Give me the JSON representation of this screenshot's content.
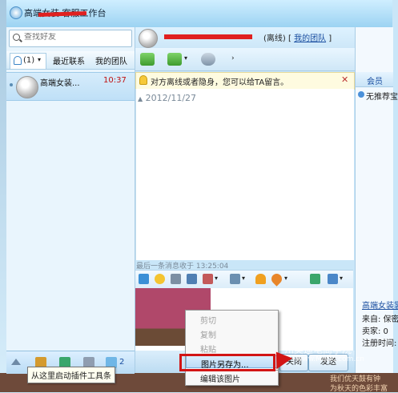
{
  "window": {
    "title": "高端女装 客服工作台"
  },
  "search": {
    "placeholder": "查找好友"
  },
  "tabs": {
    "contacts_count": "(1)",
    "recent": "最近联系",
    "team": "我的团队"
  },
  "contact": {
    "name": "高端女装...",
    "time": "10:37"
  },
  "left_toolbar": {
    "badge": "2"
  },
  "tooltip": "从这里启动插件工具条",
  "chat": {
    "status": "(离线)",
    "team_link": "我的团队",
    "notice": "对方离线或者隐身，您可以给TA留言。",
    "notice_close": "✕",
    "date_separator": "2012/11/27",
    "last_message": "最后一条消息收于 13:25:04",
    "send_label": "发送",
    "close_label": "关闭"
  },
  "right_panel": {
    "tab_label": "会员",
    "not_saved": "无推荐宝",
    "shop_link": "高端女装裳",
    "lines": [
      "来自: 保密",
      "卖家: 0",
      "注册时间:"
    ]
  },
  "context_menu": {
    "items": [
      {
        "label": "剪切",
        "enabled": false
      },
      {
        "label": "复制",
        "enabled": false
      },
      {
        "label": "粘贴",
        "enabled": false
      },
      {
        "label": "图片另存为...",
        "enabled": true
      },
      {
        "label": "编辑该图片",
        "enabled": true
      }
    ]
  },
  "watermark": {
    "logo": "MD",
    "line1": "广州美迪电商学院",
    "line2": "www.MeDc.com.cn",
    "line3": "我们优天鼓有钟",
    "line4": "为秋天的色彩丰富"
  },
  "colors": {
    "title_bar": "#9cd3f2",
    "accent": "#1a4ea0",
    "highlight": "#d21515"
  }
}
